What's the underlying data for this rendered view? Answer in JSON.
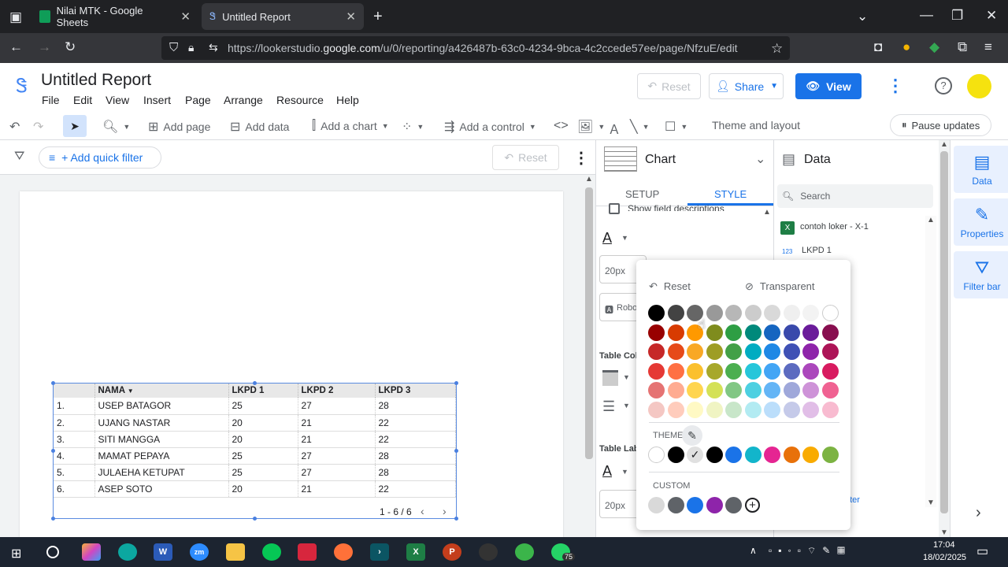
{
  "browser": {
    "tabs": [
      {
        "label": "Nilai MTK - Google Sheets",
        "active": false
      },
      {
        "label": "Untitled Report",
        "active": true
      }
    ],
    "url_prefix": "https://lookerstudio.",
    "url_domain": "google.com",
    "url_path": "/u/0/reporting/a426487b-63c0-4234-9bca-4c2ccede57ee/page/NfzuE/edit"
  },
  "app": {
    "title": "Untitled Report",
    "menu": [
      "File",
      "Edit",
      "View",
      "Insert",
      "Page",
      "Arrange",
      "Resource",
      "Help"
    ],
    "reset_label": "Reset",
    "share_label": "Share",
    "view_label": "View"
  },
  "toolbar": {
    "add_page": "Add page",
    "add_data": "Add data",
    "add_chart": "Add a chart",
    "add_control": "Add a control",
    "theme_layout": "Theme and layout",
    "pause_updates": "Pause updates"
  },
  "filterbar": {
    "add_quick_filter": "+ Add quick filter",
    "reset": "Reset"
  },
  "table": {
    "headers": [
      "",
      "NAMA",
      "LKPD 1",
      "LKPD 2",
      "LKPD 3"
    ],
    "rows": [
      [
        "1.",
        "USEP BATAGOR",
        "25",
        "27",
        "28"
      ],
      [
        "2.",
        "UJANG NASTAR",
        "20",
        "21",
        "22"
      ],
      [
        "3.",
        "SITI MANGGA",
        "20",
        "21",
        "22"
      ],
      [
        "4.",
        "MAMAT PEPAYA",
        "25",
        "27",
        "28"
      ],
      [
        "5.",
        "JULAEHA KETUPAT",
        "25",
        "27",
        "28"
      ],
      [
        "6.",
        "ASEP SOTO",
        "20",
        "21",
        "22"
      ]
    ],
    "pagination": "1 - 6 / 6"
  },
  "chart_panel": {
    "title": "Chart",
    "tab_setup": "SETUP",
    "tab_style": "STYLE",
    "show_field_desc": "Show field descriptions",
    "font_size": "20px",
    "font_family": "Robo",
    "table_colors": "Table Colo",
    "table_labels": "Table Labe",
    "font_size2": "20px"
  },
  "data_panel": {
    "title": "Data",
    "search_placeholder": "Search",
    "source": "contoh loker - X-1",
    "field_type": "123",
    "field": "LKPD 1",
    "link": "eter"
  },
  "right_rail": {
    "data": "Data",
    "properties": "Properties",
    "filter_bar": "Filter bar"
  },
  "picker": {
    "reset": "Reset",
    "transparent": "Transparent",
    "theme_label": "THEME",
    "custom_label": "CUSTOM",
    "grid": [
      [
        "#000000",
        "#434343",
        "#666666",
        "#999999",
        "#b7b7b7",
        "#cccccc",
        "#d9d9d9",
        "#efefef",
        "#f3f3f3",
        "#ffffff"
      ],
      [
        "#980000",
        "#d83b01",
        "#ff9900",
        "#7f8c1d",
        "#2e9e44",
        "#00897b",
        "#1565c0",
        "#3949ab",
        "#6a1b9a",
        "#880e4f"
      ],
      [
        "#c62828",
        "#e64a19",
        "#f9a825",
        "#9e9d24",
        "#43a047",
        "#00acc1",
        "#1e88e5",
        "#3f51b5",
        "#8e24aa",
        "#ad1457"
      ],
      [
        "#e53935",
        "#ff7043",
        "#fbc02d",
        "#a7a82b",
        "#4caf50",
        "#26c6da",
        "#42a5f5",
        "#5c6bc0",
        "#ab47bc",
        "#d81b60"
      ],
      [
        "#e57373",
        "#ffab91",
        "#ffd54f",
        "#d4e157",
        "#81c784",
        "#4dd0e1",
        "#64b5f6",
        "#9fa8da",
        "#ce93d8",
        "#f06292"
      ],
      [
        "#f4c7c3",
        "#ffccbc",
        "#fff9c4",
        "#f0f4c3",
        "#c8e6c9",
        "#b2ebf2",
        "#bbdefb",
        "#c5cae9",
        "#e1bee7",
        "#f8bbd0"
      ]
    ],
    "theme": [
      "#ffffff",
      "#000000",
      "#e0e0e0",
      "#000000",
      "#1a73e8",
      "#12b5cb",
      "#e52592",
      "#e8710a",
      "#f9ab00",
      "#7cb342"
    ],
    "custom": [
      "#d9d9d9",
      "#5f6368",
      "#1a73e8",
      "#8e24aa",
      "#5f6368"
    ]
  },
  "taskbar": {
    "time": "17:04",
    "date": "18/02/2025",
    "badge": "75"
  }
}
